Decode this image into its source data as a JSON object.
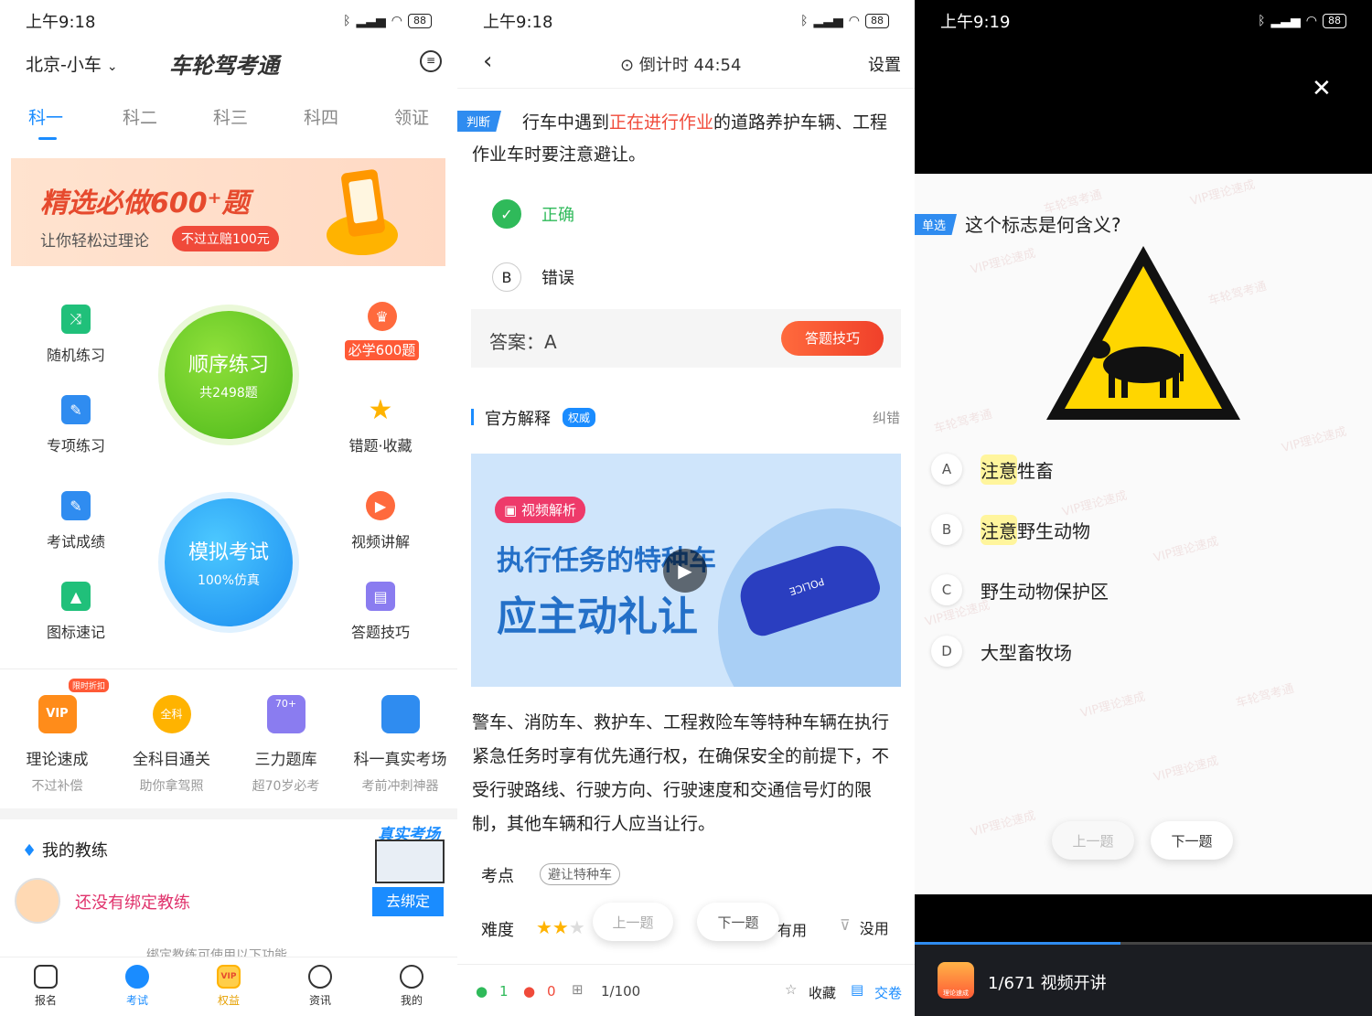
{
  "colors": {
    "accent": "#1a8cff",
    "red": "#f04a3a",
    "green": "#4cc41b",
    "blue": "#1e90ff"
  },
  "p1": {
    "status": {
      "time": "上午9:18",
      "battery": "88"
    },
    "header": {
      "city": "北京-小车",
      "logo": "车轮驾考通"
    },
    "tabs": [
      "科一",
      "科二",
      "科三",
      "科四",
      "领证"
    ],
    "banner": {
      "title": "精选必做600⁺题",
      "subtitle": "让你轻松过理论",
      "badge": "不过立赔100元"
    },
    "features": {
      "random": "随机练习",
      "topic": "专项练习",
      "score": "考试成绩",
      "signs": "图标速记",
      "must600": "必学600题",
      "wrong": "错题·收藏",
      "video": "视频讲解",
      "skills": "答题技巧"
    },
    "seq": {
      "title": "顺序练习",
      "sub": "共2498题"
    },
    "mock": {
      "title": "模拟考试",
      "sub": "100%仿真"
    },
    "vip": [
      {
        "t": "理论速成",
        "s": "不过补偿",
        "badge": "限时折扣",
        "icon": "VIP"
      },
      {
        "t": "全科目通关",
        "s": "助你拿驾照",
        "icon": "全科"
      },
      {
        "t": "三力题库",
        "s": "超70岁必考",
        "icon": "70+"
      },
      {
        "t": "科一真实考场",
        "s": "考前冲刺神器",
        "icon": ""
      }
    ],
    "coach": {
      "title": "我的教练",
      "empty": "还没有绑定教练",
      "bind": "去绑定",
      "banner": "真实考场",
      "hint": "绑定教练可使用以下功能"
    },
    "nav": [
      "报名",
      "考试",
      "权益",
      "资讯",
      "我的"
    ],
    "nav_icons": [
      "VIP"
    ]
  },
  "p2": {
    "status": {
      "time": "上午9:18",
      "battery": "88"
    },
    "timer": "倒计时 44:54",
    "settings": "设置",
    "qtype": "判断",
    "question": {
      "pre": "行车中遇到",
      "hl": "正在进行作业",
      "post": "的道路养护车辆、工程作业车时要注意避让。"
    },
    "options": [
      {
        "letter": "✓",
        "text": "正确"
      },
      {
        "letter": "B",
        "text": "错误"
      }
    ],
    "answer": "答案：A",
    "tips_btn": "答题技巧",
    "explain": {
      "title": "官方解释",
      "badge": "权威",
      "report": "纠错"
    },
    "video": {
      "tag": "视频解析",
      "line1": "执行任务的特种车",
      "line2": "应主动礼让",
      "car": "POLICE"
    },
    "body": "警车、消防车、救护车、工程救险车等特种车辆在执行紧急任务时享有优先通行权，在确保安全的前提下，不受行驶路线、行驶方向、行驶速度和交通信号灯的限制，其他车辆和行人应当让行。",
    "point_label": "考点",
    "point_tag": "避让特种车",
    "difficulty_label": "难度",
    "difficulty": 2,
    "prev": "上一题",
    "next": "下一题",
    "useful": "有用",
    "useless": "没用",
    "bottom": {
      "right": "1",
      "wrong": "0",
      "progress": "1/100",
      "fav": "收藏",
      "submit": "交卷"
    }
  },
  "p3": {
    "status": {
      "time": "上午9:19",
      "battery": "88"
    },
    "close": "✕",
    "qtype": "单选",
    "question": "这个标志是何含义?",
    "options": [
      {
        "letter": "A",
        "hl": "注意",
        "text": "牲畜"
      },
      {
        "letter": "B",
        "hl": "注意",
        "text": "野生动物"
      },
      {
        "letter": "C",
        "hl": "",
        "text": "野生动物保护区"
      },
      {
        "letter": "D",
        "hl": "",
        "text": "大型畜牧场"
      }
    ],
    "prev": "上一题",
    "next": "下一题",
    "player": {
      "app": "理论速成",
      "caption": "1/671 视频开讲",
      "progress": 0.45
    },
    "watermarks": [
      "车轮驾考通",
      "VIP理论速成"
    ]
  }
}
